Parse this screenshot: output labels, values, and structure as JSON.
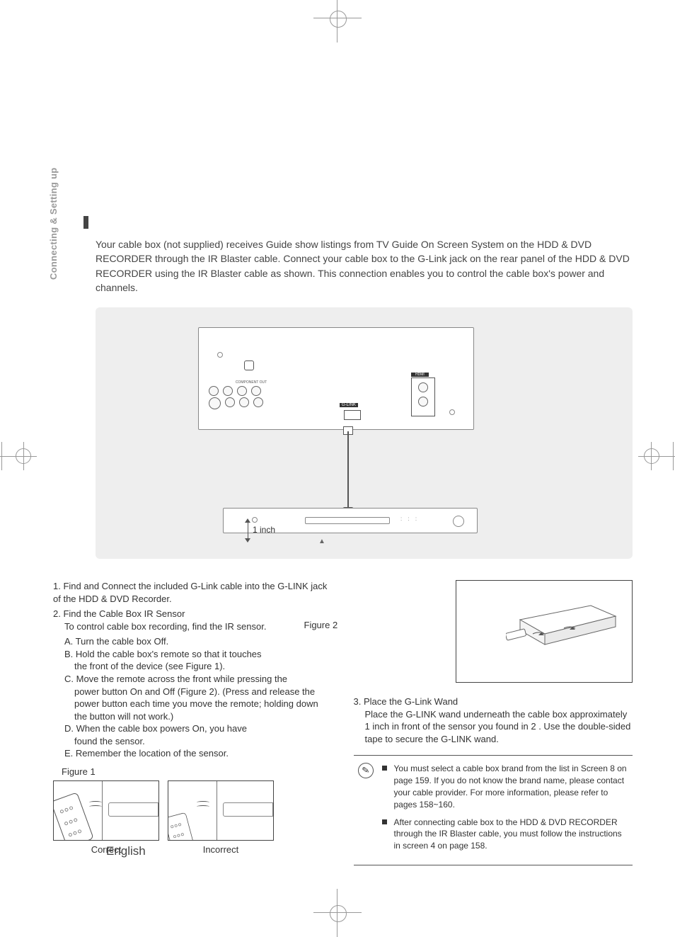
{
  "section_tab": "Connecting & Setting up",
  "intro": "Your cable box (not supplied) receives Guide show listings from TV Guide On Screen System on the HDD & DVD RECORDER through the IR Blaster cable. Connect your cable box to the G-Link jack on the rear panel of the HDD & DVD RECORDER using the IR Blaster cable as shown. This connection enables you to control the cable box's power and channels.",
  "diagram": {
    "distance_label": "1 inch",
    "glink_label": "G-LINK",
    "hdmi_label": "HDMI",
    "component_label": "COMPONENT OUT"
  },
  "steps_left": {
    "s1_num": "1.",
    "s1_title": "Find and Connect the included G-Link cable into the G-LINK jack of the HDD & DVD Recorder.",
    "s2_num": "2.",
    "s2_title": "Find the Cable Box IR Sensor",
    "s2_body": "To control cable box recording, find the IR sensor.",
    "a": "A. Turn the cable box Off.",
    "b": "B. Hold the cable box's remote so that it touches",
    "b2": "the front of the device (see Figure 1).",
    "c": "C. Move the remote across the front while pressing the",
    "c2": "power button On and Off (Figure 2). (Press and release the power button each time you move the remote; holding down the button will not work.)",
    "d": "D. When the cable box powers On, you have",
    "d2": "found the sensor.",
    "e": "E. Remember the location of the sensor.",
    "fig1": "Figure 1",
    "correct": "Correct",
    "incorrect": "Incorrect"
  },
  "steps_right": {
    "fig2": "Figure 2",
    "s3_num": "3.",
    "s3_title": "Place the G-Link Wand",
    "s3_body": "Place the G-LINK wand underneath the cable box approximately 1 inch in front of the sensor you found in 2 . Use the double-sided tape to secure the G-LINK wand."
  },
  "notes": {
    "n1": "You must select a cable box brand from the list in Screen 8 on page 159. If you do not know the brand name, please contact your cable provider. For more information, please refer to pages 158~160.",
    "n2": "After connecting cable box to the HDD & DVD RECORDER through the IR Blaster cable, you must follow the instructions in screen 4 on page 158."
  },
  "footer": {
    "language": "English"
  }
}
